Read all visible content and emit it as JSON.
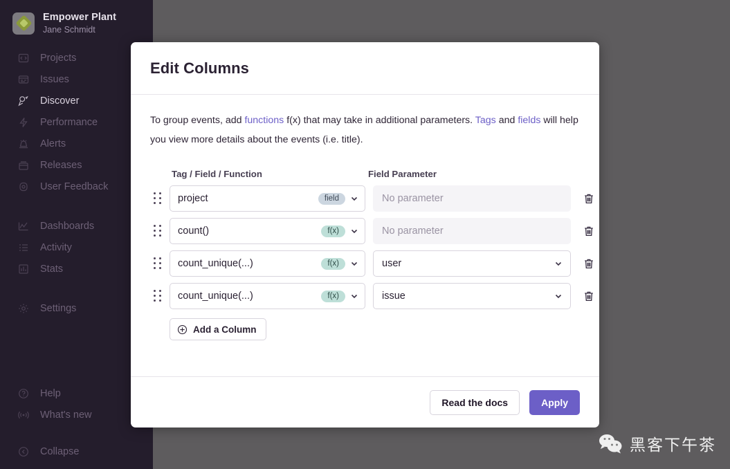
{
  "sidebar": {
    "org": {
      "name": "Empower Plant",
      "user": "Jane Schmidt",
      "logo_icon": "empower-plant-logo"
    },
    "groups": [
      {
        "items": [
          {
            "label": "Projects",
            "icon": "projects-icon",
            "active": false
          },
          {
            "label": "Issues",
            "icon": "issues-icon",
            "active": false
          },
          {
            "label": "Discover",
            "icon": "discover-icon",
            "active": true
          },
          {
            "label": "Performance",
            "icon": "performance-icon",
            "active": false
          },
          {
            "label": "Alerts",
            "icon": "alerts-icon",
            "active": false
          },
          {
            "label": "Releases",
            "icon": "releases-icon",
            "active": false
          },
          {
            "label": "User Feedback",
            "icon": "user-feedback-icon",
            "active": false
          }
        ]
      },
      {
        "items": [
          {
            "label": "Dashboards",
            "icon": "dashboards-icon",
            "active": false
          },
          {
            "label": "Activity",
            "icon": "activity-icon",
            "active": false
          },
          {
            "label": "Stats",
            "icon": "stats-icon",
            "active": false
          }
        ]
      },
      {
        "items": [
          {
            "label": "Settings",
            "icon": "settings-icon",
            "active": false
          }
        ]
      }
    ],
    "bottom_groups": [
      {
        "items": [
          {
            "label": "Help",
            "icon": "help-icon",
            "active": false
          },
          {
            "label": "What's new",
            "icon": "whats-new-icon",
            "active": false
          }
        ]
      },
      {
        "items": [
          {
            "label": "Collapse",
            "icon": "collapse-icon",
            "active": false
          }
        ]
      }
    ]
  },
  "modal": {
    "title": "Edit Columns",
    "intro": {
      "part1": "To group events, add ",
      "link_functions": "functions",
      "part2": " f(x) that may take in additional parameters. ",
      "link_tags": "Tags",
      "part3": " and ",
      "link_fields": "fields",
      "part4": " will help you view more details about the events (i.e. title)."
    },
    "headers": {
      "col1": "Tag / Field / Function",
      "col2": "Field Parameter"
    },
    "rows": [
      {
        "drag_icon": "drag-handle-icon",
        "value": "project",
        "badge": "field",
        "badge_type": "field",
        "param_value": "No parameter",
        "param_enabled": false,
        "delete_icon": "trash-icon"
      },
      {
        "drag_icon": "drag-handle-icon",
        "value": "count()",
        "badge": "f(x)",
        "badge_type": "fx",
        "param_value": "No parameter",
        "param_enabled": false,
        "delete_icon": "trash-icon"
      },
      {
        "drag_icon": "drag-handle-icon",
        "value": "count_unique(...)",
        "badge": "f(x)",
        "badge_type": "fx",
        "param_value": "user",
        "param_enabled": true,
        "delete_icon": "trash-icon"
      },
      {
        "drag_icon": "drag-handle-icon",
        "value": "count_unique(...)",
        "badge": "f(x)",
        "badge_type": "fx",
        "param_value": "issue",
        "param_enabled": true,
        "delete_icon": "trash-icon"
      }
    ],
    "add_column_label": "Add a Column",
    "add_column_icon": "plus-circle-icon",
    "footer": {
      "secondary": "Read the docs",
      "primary": "Apply"
    }
  },
  "watermark": {
    "text": "黑客下午茶",
    "icon": "wechat-icon"
  },
  "colors": {
    "sidebar_bg": "#241d2c",
    "backdrop": "#5e5c5e",
    "accent": "#6c5fc7",
    "link": "#6c5fc7",
    "badge_field_bg": "#ccd6e0",
    "badge_fx_bg": "#bedfd8",
    "logo_green": "#8a9a3a"
  }
}
